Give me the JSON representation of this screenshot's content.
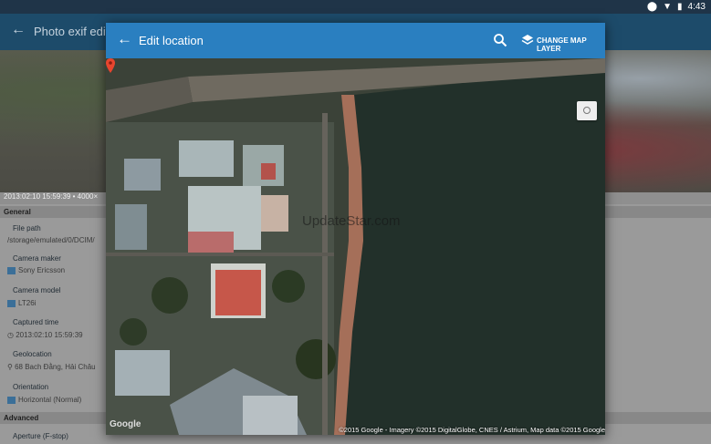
{
  "status_bar": {
    "time": "4:43"
  },
  "background_app": {
    "title": "Photo exif edit",
    "photo_caption": "2013:02:10 15:59:39 • 4000×",
    "sections": {
      "general": "General",
      "advanced": "Advanced"
    },
    "fields": [
      {
        "label": "File path",
        "value": "/storage/emulated/0/DCIM/"
      },
      {
        "label": "Camera maker",
        "value": "Sony Ericsson"
      },
      {
        "label": "Camera model",
        "value": "LT26i"
      },
      {
        "label": "Captured time",
        "value": "2013:02:10 15:59:39"
      },
      {
        "label": "Geolocation",
        "value": "68 Bach Đằng, Hải Châu"
      },
      {
        "label": "Orientation",
        "value": "Horizontal (Normal)"
      }
    ],
    "advanced_first": "Aperture (F-stop)"
  },
  "dialog": {
    "title": "Edit location",
    "change_map_layer": "CHANGE MAP LAYER",
    "watermark": "UpdateStar.com",
    "google_logo": "Google",
    "attribution": "©2015 Google - Imagery ©2015 DigitalGlobe, CNES / Astrium, Map data ©2015 Google"
  },
  "colors": {
    "dialog_bar": "#2a7fc0",
    "app_bar": "#1d4b6a",
    "pin": "#e8452e"
  }
}
